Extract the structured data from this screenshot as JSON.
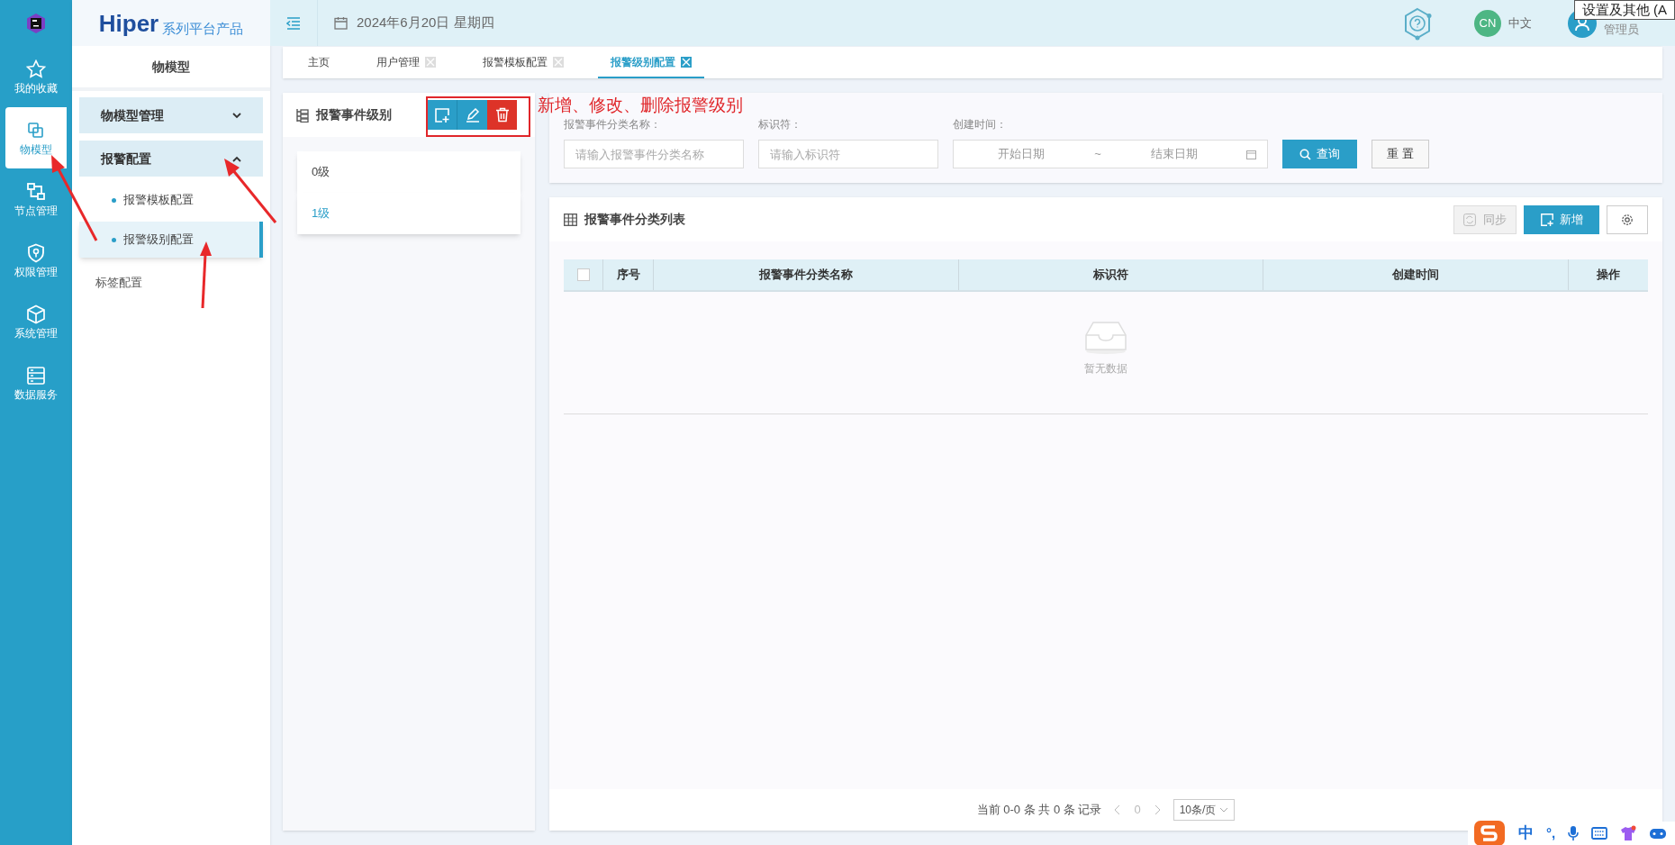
{
  "rail": [
    {
      "label": "我的收藏",
      "selected": false
    },
    {
      "label": "物模型",
      "selected": true
    },
    {
      "label": "节点管理",
      "selected": false
    },
    {
      "label": "权限管理",
      "selected": false
    },
    {
      "label": "系统管理",
      "selected": false
    },
    {
      "label": "数据服务",
      "selected": false
    }
  ],
  "logo": {
    "brand": "Hiper",
    "subtitle": "系列平台产品"
  },
  "sidebar": {
    "title": "物模型",
    "items": [
      {
        "kind": "group",
        "label": "物模型管理",
        "expanded": false,
        "selected": false
      },
      {
        "kind": "group",
        "label": "报警配置",
        "expanded": true,
        "selected": false,
        "children": [
          {
            "label": "报警模板配置",
            "selected": false
          },
          {
            "label": "报警级别配置",
            "selected": true
          }
        ]
      },
      {
        "kind": "link",
        "label": "标签配置",
        "selected": false
      }
    ]
  },
  "header": {
    "date": "2024年6月20日 星期四",
    "lang_badge": "CN",
    "lang": "中文",
    "user": "管理员",
    "tooltip": "设置及其他 (A"
  },
  "tabs": [
    {
      "label": "主页",
      "closable": false,
      "selected": false
    },
    {
      "label": "用户管理",
      "closable": true,
      "selected": false
    },
    {
      "label": "报警模板配置",
      "closable": true,
      "selected": false
    },
    {
      "label": "报警级别配置",
      "closable": true,
      "selected": true
    }
  ],
  "levels_panel": {
    "title": "报警事件级别",
    "items": [
      {
        "label": "0级",
        "selected": false
      },
      {
        "label": "1级",
        "selected": true
      }
    ]
  },
  "annotation": "新增、修改、删除报警级别",
  "filters": [
    {
      "label": "报警事件分类名称：",
      "placeholder": "请输入报警事件分类名称"
    },
    {
      "label": "标识符：",
      "placeholder": "请输入标识符"
    }
  ],
  "date_filter": {
    "label": "创建时间：",
    "start": "开始日期",
    "sep": "~",
    "end": "结束日期"
  },
  "search_button": "查询",
  "reset_button": "重 置",
  "table": {
    "title": "报警事件分类列表",
    "sync_button": "同步",
    "add_button": "新增",
    "select_all_checked": false,
    "columns": [
      "序号",
      "报警事件分类名称",
      "标识符",
      "创建时间",
      "操作"
    ],
    "empty": "暂无数据"
  },
  "pagination": {
    "summary": "当前 0-0 条 共 0 条 记录",
    "page": "0",
    "page_size": "10条/页"
  },
  "ime": {
    "mode": "中",
    "punct": "°,"
  }
}
